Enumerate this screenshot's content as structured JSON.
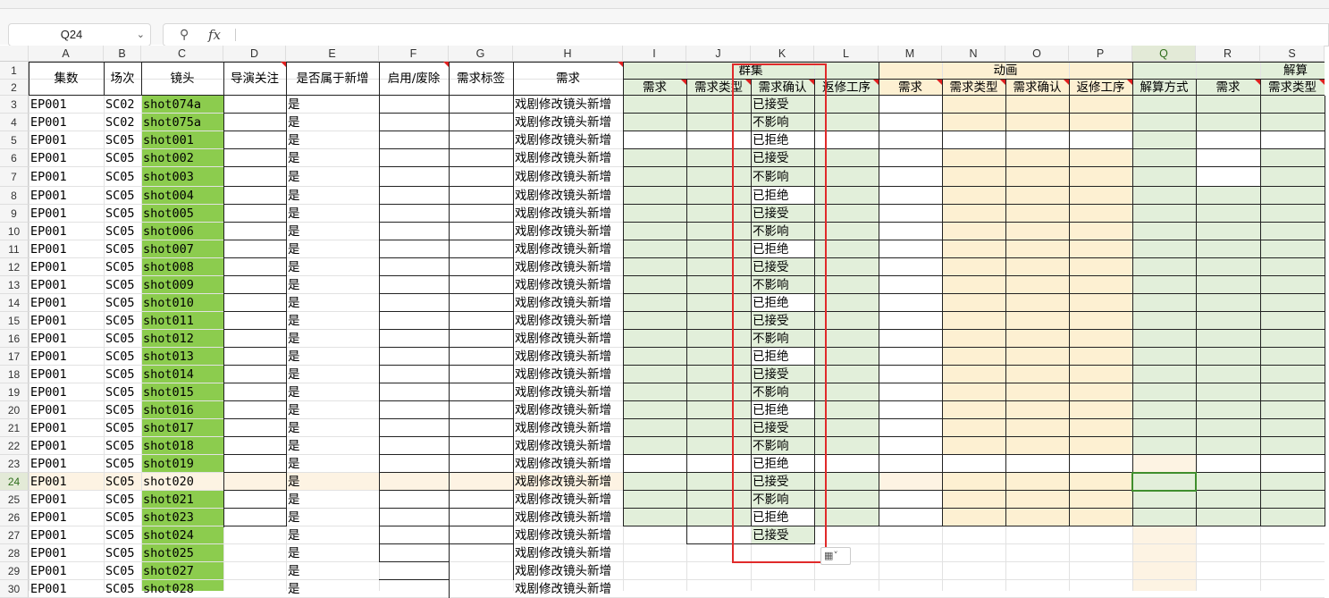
{
  "namebox": {
    "value": "Q24"
  },
  "formula": {
    "value": ""
  },
  "columns": [
    "A",
    "B",
    "C",
    "D",
    "E",
    "F",
    "G",
    "H",
    "I",
    "J",
    "K",
    "L",
    "M",
    "N",
    "O",
    "P",
    "Q",
    "R",
    "S"
  ],
  "rows": [
    "1",
    "2",
    "3",
    "4",
    "5",
    "6",
    "7",
    "8",
    "9",
    "10",
    "11",
    "12",
    "13",
    "14",
    "15",
    "16",
    "17",
    "18",
    "19",
    "20",
    "21",
    "22",
    "23",
    "24",
    "25",
    "26",
    "27",
    "28",
    "29",
    "30"
  ],
  "headers": {
    "A": "集数",
    "B": "场次",
    "C": "镜头",
    "D": "导演关注",
    "E": "是否属于新增",
    "F": "启用/废除",
    "G": "需求标签",
    "H": "需求",
    "group_qunji": "群集",
    "group_donghua": "动画",
    "group_jiesuan": "解算",
    "I": "需求",
    "J": "需求类型",
    "K": "需求确认",
    "L": "返修工序",
    "M": "需求",
    "N": "需求类型",
    "O": "需求确认",
    "P": "返修工序",
    "Q": "解算方式",
    "R": "需求",
    "S": "需求类型"
  },
  "data": [
    {
      "row": "3",
      "ep": "EP001",
      "sc": "SC02",
      "shot": "shot074a",
      "new": "是",
      "req": "戏剧修改镜头新增",
      "confirm": "已接受"
    },
    {
      "row": "4",
      "ep": "EP001",
      "sc": "SC02",
      "shot": "shot075a",
      "new": "是",
      "req": "戏剧修改镜头新增",
      "confirm": "不影响"
    },
    {
      "row": "5",
      "ep": "EP001",
      "sc": "SC05",
      "shot": "shot001",
      "new": "是",
      "req": "戏剧修改镜头新增",
      "confirm": "已拒绝"
    },
    {
      "row": "6",
      "ep": "EP001",
      "sc": "SC05",
      "shot": "shot002",
      "new": "是",
      "req": "戏剧修改镜头新增",
      "confirm": "已接受"
    },
    {
      "row": "7",
      "ep": "EP001",
      "sc": "SC05",
      "shot": "shot003",
      "new": "是",
      "req": "戏剧修改镜头新增",
      "confirm": "不影响"
    },
    {
      "row": "8",
      "ep": "EP001",
      "sc": "SC05",
      "shot": "shot004",
      "new": "是",
      "req": "戏剧修改镜头新增",
      "confirm": "已拒绝"
    },
    {
      "row": "9",
      "ep": "EP001",
      "sc": "SC05",
      "shot": "shot005",
      "new": "是",
      "req": "戏剧修改镜头新增",
      "confirm": "已接受"
    },
    {
      "row": "10",
      "ep": "EP001",
      "sc": "SC05",
      "shot": "shot006",
      "new": "是",
      "req": "戏剧修改镜头新增",
      "confirm": "不影响"
    },
    {
      "row": "11",
      "ep": "EP001",
      "sc": "SC05",
      "shot": "shot007",
      "new": "是",
      "req": "戏剧修改镜头新增",
      "confirm": "已拒绝"
    },
    {
      "row": "12",
      "ep": "EP001",
      "sc": "SC05",
      "shot": "shot008",
      "new": "是",
      "req": "戏剧修改镜头新增",
      "confirm": "已接受"
    },
    {
      "row": "13",
      "ep": "EP001",
      "sc": "SC05",
      "shot": "shot009",
      "new": "是",
      "req": "戏剧修改镜头新增",
      "confirm": "不影响"
    },
    {
      "row": "14",
      "ep": "EP001",
      "sc": "SC05",
      "shot": "shot010",
      "new": "是",
      "req": "戏剧修改镜头新增",
      "confirm": "已拒绝"
    },
    {
      "row": "15",
      "ep": "EP001",
      "sc": "SC05",
      "shot": "shot011",
      "new": "是",
      "req": "戏剧修改镜头新增",
      "confirm": "已接受"
    },
    {
      "row": "16",
      "ep": "EP001",
      "sc": "SC05",
      "shot": "shot012",
      "new": "是",
      "req": "戏剧修改镜头新增",
      "confirm": "不影响"
    },
    {
      "row": "17",
      "ep": "EP001",
      "sc": "SC05",
      "shot": "shot013",
      "new": "是",
      "req": "戏剧修改镜头新增",
      "confirm": "已拒绝"
    },
    {
      "row": "18",
      "ep": "EP001",
      "sc": "SC05",
      "shot": "shot014",
      "new": "是",
      "req": "戏剧修改镜头新增",
      "confirm": "已接受"
    },
    {
      "row": "19",
      "ep": "EP001",
      "sc": "SC05",
      "shot": "shot015",
      "new": "是",
      "req": "戏剧修改镜头新增",
      "confirm": "不影响"
    },
    {
      "row": "20",
      "ep": "EP001",
      "sc": "SC05",
      "shot": "shot016",
      "new": "是",
      "req": "戏剧修改镜头新增",
      "confirm": "已拒绝"
    },
    {
      "row": "21",
      "ep": "EP001",
      "sc": "SC05",
      "shot": "shot017",
      "new": "是",
      "req": "戏剧修改镜头新增",
      "confirm": "已接受"
    },
    {
      "row": "22",
      "ep": "EP001",
      "sc": "SC05",
      "shot": "shot018",
      "new": "是",
      "req": "戏剧修改镜头新增",
      "confirm": "不影响"
    },
    {
      "row": "23",
      "ep": "EP001",
      "sc": "SC05",
      "shot": "shot019",
      "new": "是",
      "req": "戏剧修改镜头新增",
      "confirm": "已拒绝"
    },
    {
      "row": "24",
      "ep": "EP001",
      "sc": "SC05",
      "shot": "shot020",
      "new": "是",
      "req": "戏剧修改镜头新增",
      "confirm": "已接受"
    },
    {
      "row": "25",
      "ep": "EP001",
      "sc": "SC05",
      "shot": "shot021",
      "new": "是",
      "req": "戏剧修改镜头新增",
      "confirm": "不影响"
    },
    {
      "row": "26",
      "ep": "EP001",
      "sc": "SC05",
      "shot": "shot023",
      "new": "是",
      "req": "戏剧修改镜头新增",
      "confirm": "已拒绝"
    },
    {
      "row": "27",
      "ep": "EP001",
      "sc": "SC05",
      "shot": "shot024",
      "new": "是",
      "req": "戏剧修改镜头新增",
      "confirm": "已接受"
    },
    {
      "row": "28",
      "ep": "EP001",
      "sc": "SC05",
      "shot": "shot025",
      "new": "是",
      "req": "戏剧修改镜头新增",
      "confirm": ""
    },
    {
      "row": "29",
      "ep": "EP001",
      "sc": "SC05",
      "shot": "shot027",
      "new": "是",
      "req": "戏剧修改镜头新增",
      "confirm": ""
    },
    {
      "row": "30",
      "ep": "EP001",
      "sc": "SC05",
      "shot": "shot028",
      "new": "是",
      "req": "戏剧修改镜头新增",
      "confirm": ""
    }
  ],
  "colors": {
    "shot_green": "#8ccc4e",
    "group_green": "#e2efda",
    "group_orange": "#fdf0d2",
    "selected_row": "#fdf3e3",
    "selected_cell": "#3f8e2d",
    "annotation_red": "#e02a2a"
  },
  "icons": {
    "paste_options": "paste-options-icon"
  }
}
